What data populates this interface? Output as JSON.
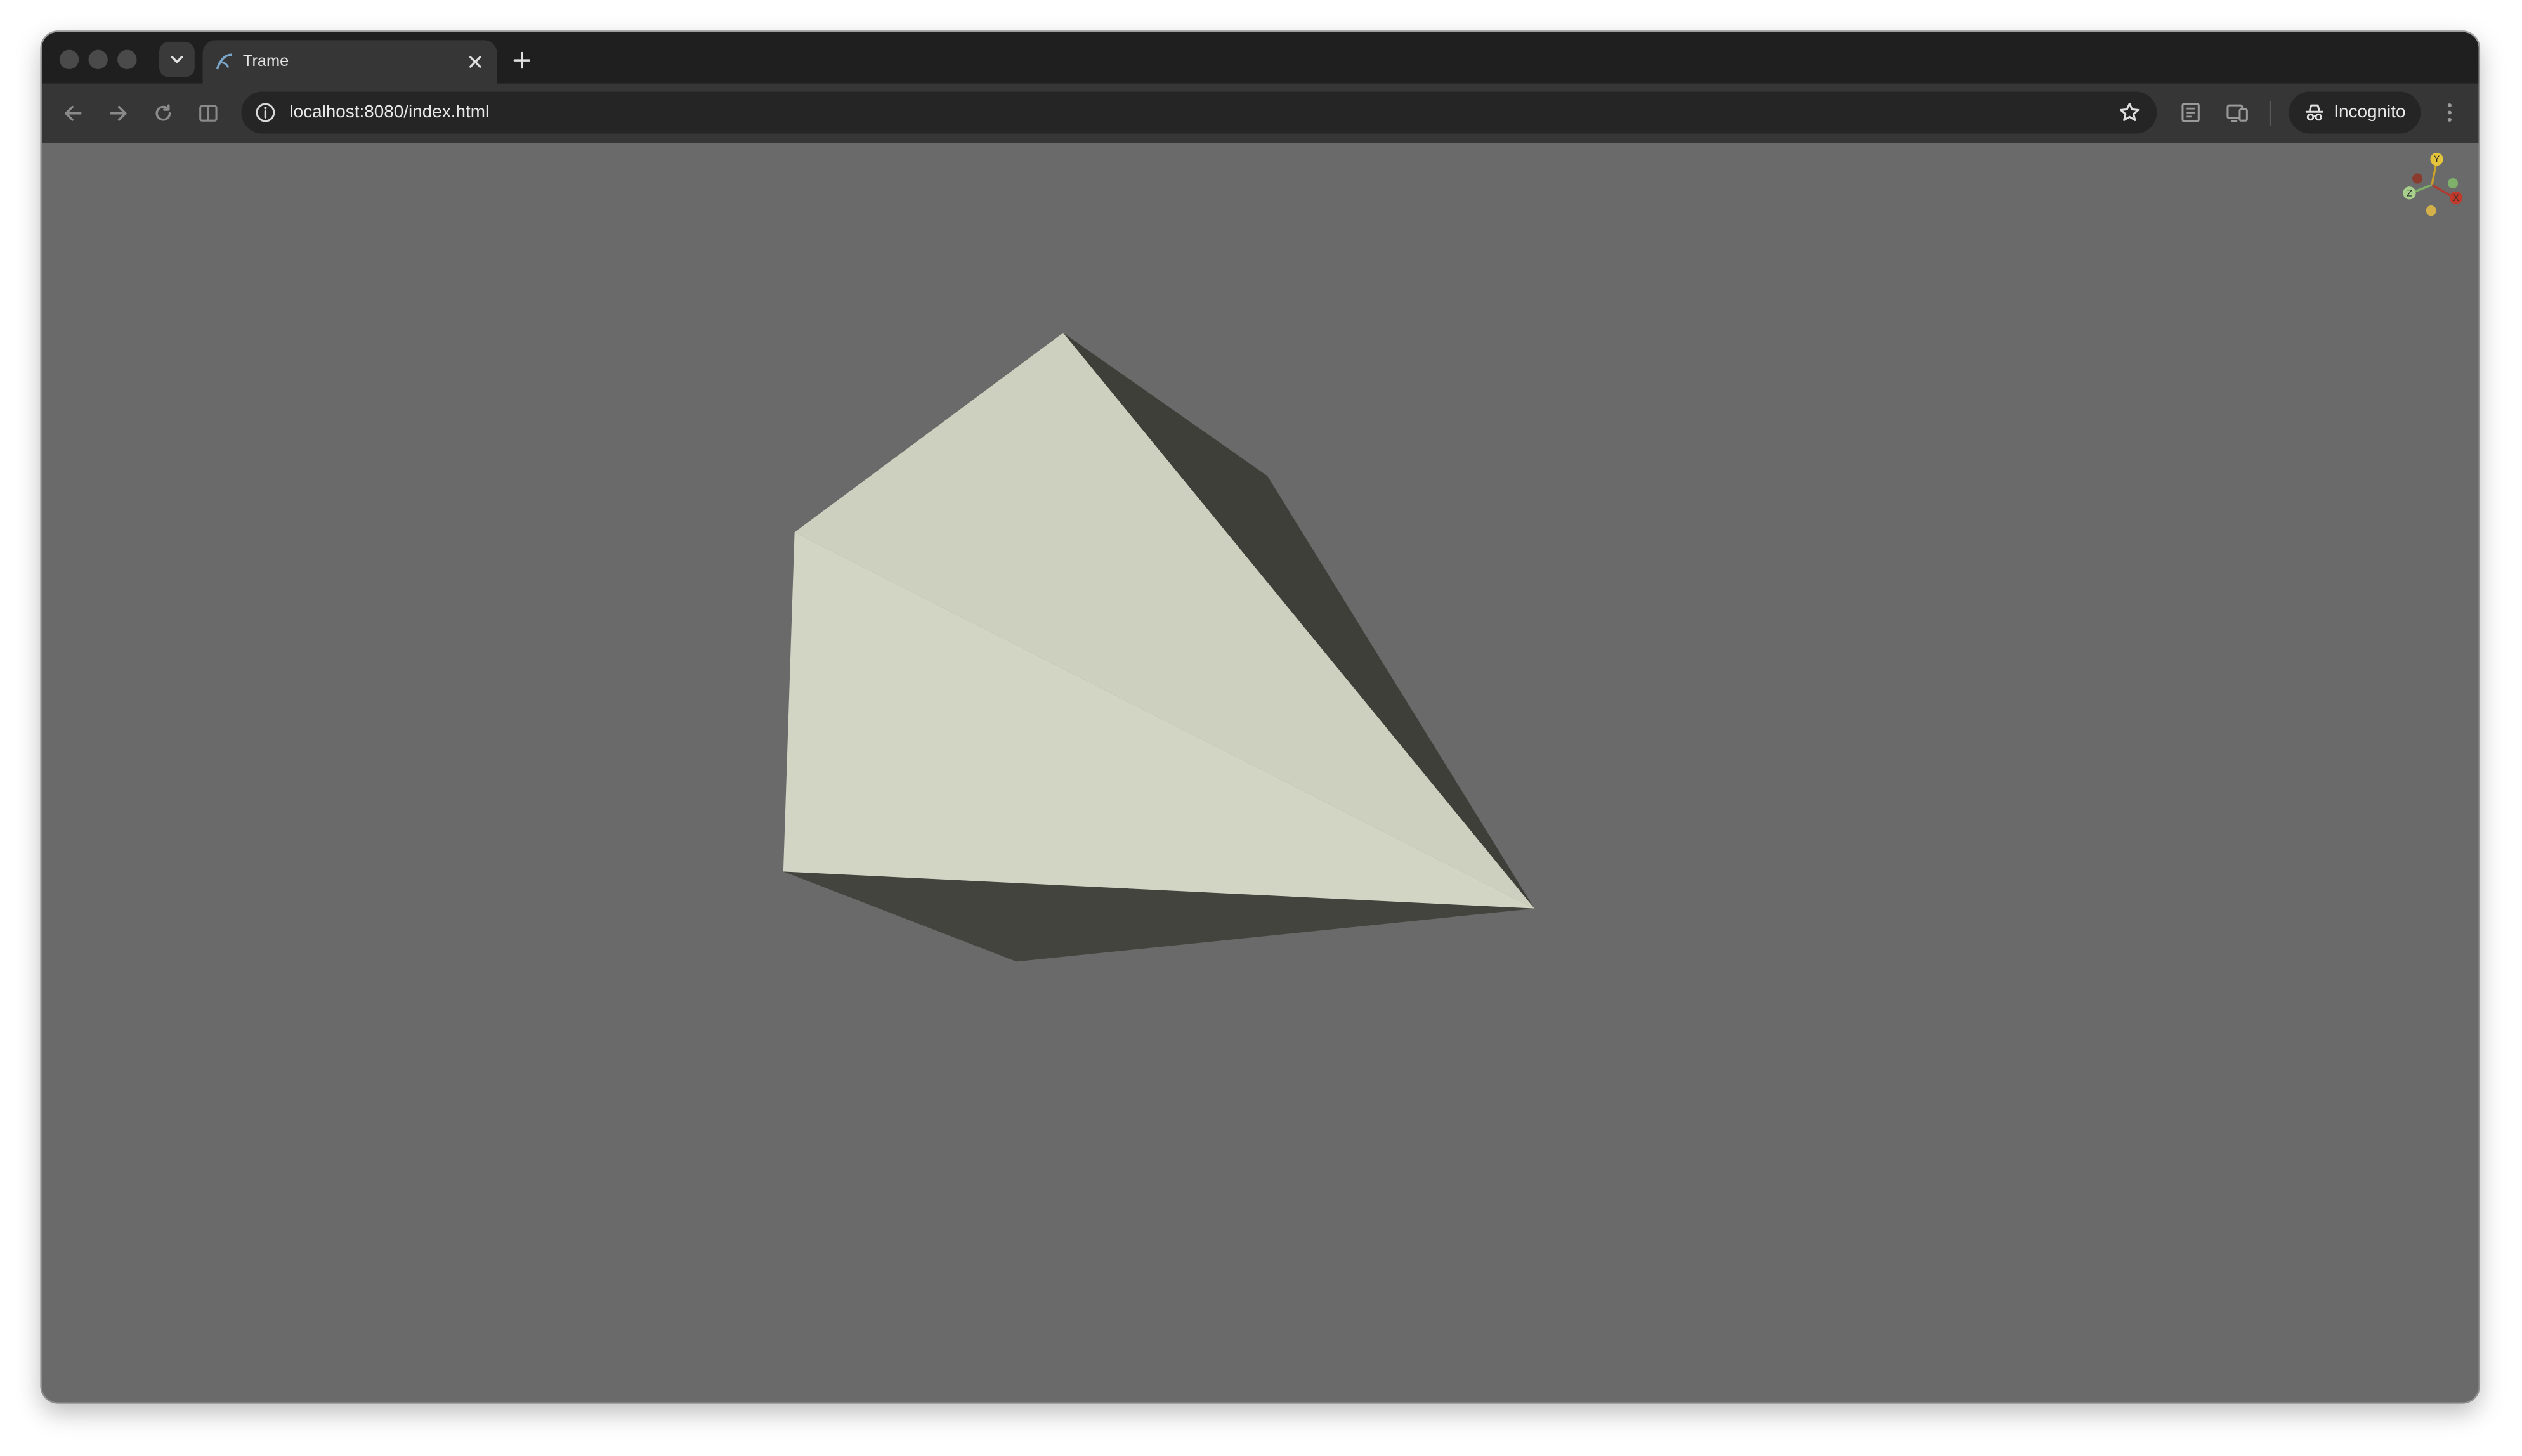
{
  "browser": {
    "tab": {
      "title": "Trame"
    },
    "address_bar": {
      "url": "localhost:8080/index.html"
    },
    "profile": {
      "label": "Incognito"
    }
  },
  "viewport": {
    "background": "#6a6a6a",
    "mesh": {
      "light_face_color": "#d2d4c4",
      "shadow_face_color": "#3e3f38"
    },
    "orientation_axes": {
      "x_label": "X",
      "y_label": "Y",
      "z_label": "Z"
    }
  },
  "colors": {
    "tabstrip": "#1f1f1f",
    "toolbar": "#363636",
    "omnibox": "#252525"
  }
}
